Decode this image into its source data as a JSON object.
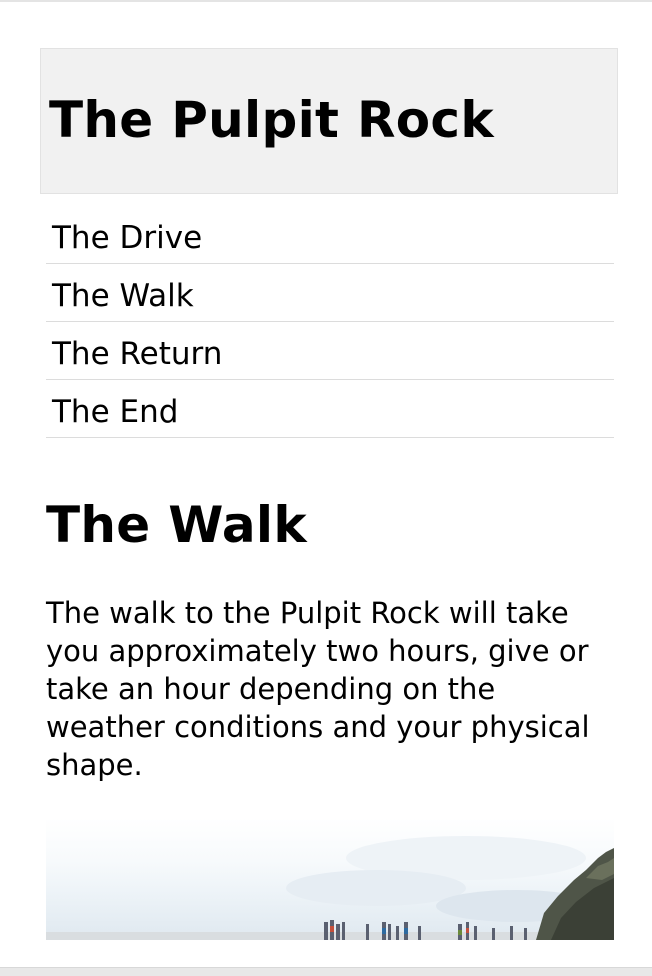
{
  "header": {
    "title": "The Pulpit Rock"
  },
  "menu": {
    "items": [
      {
        "label": "The Drive"
      },
      {
        "label": "The Walk"
      },
      {
        "label": "The Return"
      },
      {
        "label": "The End"
      }
    ]
  },
  "main": {
    "title": "The Walk",
    "paragraph": "The walk to the Pulpit Rock will take you approximately two hours, give or take an hour depending on the weather conditions and your physical shape."
  },
  "colors": {
    "header_background": "#f1f1f1",
    "divider": "#dcdcdc",
    "text": "#000000"
  }
}
